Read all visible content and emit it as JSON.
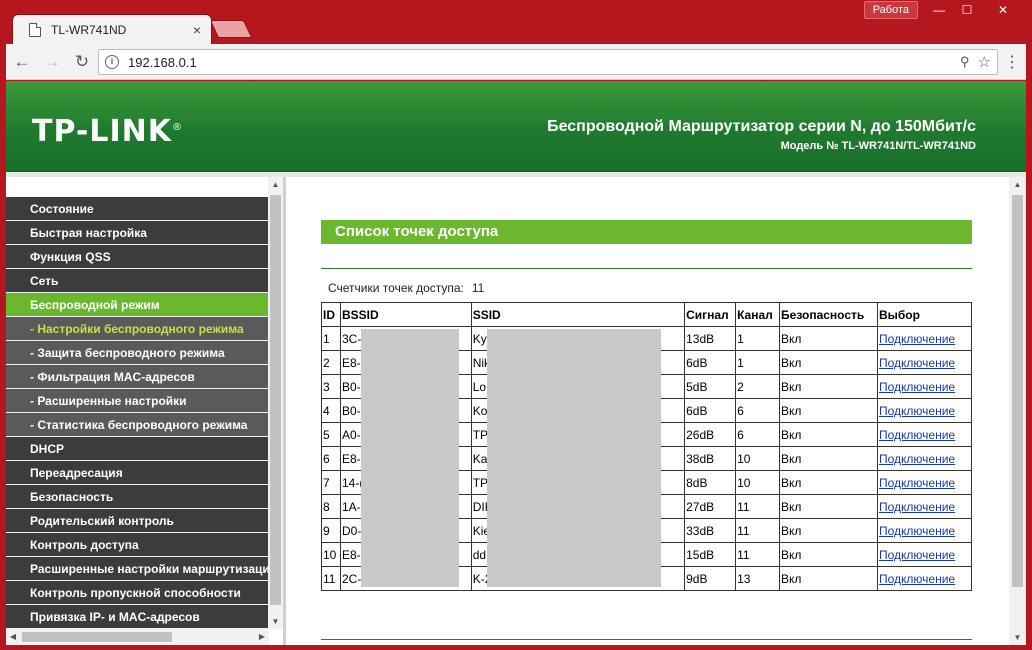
{
  "browser": {
    "tab_title": "TL-WR741ND",
    "tab_close": "×",
    "profile_label": "Работа",
    "win_minimize": "—",
    "win_maximize": "☐",
    "win_close": "✕",
    "back": "←",
    "forward": "→",
    "reload": "↻",
    "info": "i",
    "url": "192.168.0.1",
    "key": "⚲",
    "star": "☆",
    "menu": "⋮"
  },
  "banner": {
    "logo": "TP-LINK",
    "logo_mark": "®",
    "title": "Беспроводной Маршрутизатор серии N, до 150Мбит/с",
    "model": "Модель № TL-WR741N/TL-WR741ND"
  },
  "menu": [
    {
      "label": "Состояние",
      "type": "main"
    },
    {
      "label": "Быстрая настройка",
      "type": "main"
    },
    {
      "label": "Функция QSS",
      "type": "main"
    },
    {
      "label": "Сеть",
      "type": "main"
    },
    {
      "label": "Беспроводной режим",
      "type": "active"
    },
    {
      "label": "- Настройки беспроводного режима",
      "type": "sub-active"
    },
    {
      "label": "- Защита беспроводного режима",
      "type": "sub"
    },
    {
      "label": "- Фильтрация MAC-адресов",
      "type": "sub"
    },
    {
      "label": "- Расширенные настройки",
      "type": "sub"
    },
    {
      "label": "- Статистика беспроводного режима",
      "type": "sub"
    },
    {
      "label": "DHCP",
      "type": "main"
    },
    {
      "label": "Переадресация",
      "type": "main"
    },
    {
      "label": "Безопасность",
      "type": "main"
    },
    {
      "label": "Родительский контроль",
      "type": "main"
    },
    {
      "label": "Контроль доступа",
      "type": "main"
    },
    {
      "label": "Расширенные настройки маршрутизации",
      "type": "main"
    },
    {
      "label": "Контроль пропускной способности",
      "type": "main"
    },
    {
      "label": "Привязка IP- и MAC-адресов",
      "type": "main"
    }
  ],
  "main": {
    "section_title": "Список точек доступа",
    "count_label": "Счетчики точек доступа:",
    "count_value": "11",
    "columns": [
      "ID",
      "BSSID",
      "SSID",
      "Сигнал",
      "Канал",
      "Безопасность",
      "Выбор"
    ],
    "rows": [
      [
        "1",
        "3C-",
        "Ky",
        "13dB",
        "1",
        "Вкл",
        "Подключение"
      ],
      [
        "2",
        "E8-",
        "Nik",
        "6dB",
        "1",
        "Вкл",
        "Подключение"
      ],
      [
        "3",
        "B0-",
        "Lo",
        "5dB",
        "2",
        "Вкл",
        "Подключение"
      ],
      [
        "4",
        "B0-",
        "Ko",
        "6dB",
        "6",
        "Вкл",
        "Подключение"
      ],
      [
        "5",
        "A0-",
        "TP",
        "26dB",
        "6",
        "Вкл",
        "Подключение"
      ],
      [
        "6",
        "E8-",
        "Ka",
        "38dB",
        "10",
        "Вкл",
        "Подключение"
      ],
      [
        "7",
        "14-(",
        "TP",
        "8dB",
        "10",
        "Вкл",
        "Подключение"
      ],
      [
        "8",
        "1A-",
        "DIF",
        "27dB",
        "11",
        "Вкл",
        "Подключение"
      ],
      [
        "9",
        "D0-",
        "Kie",
        "33dB",
        "11",
        "Вкл",
        "Подключение"
      ],
      [
        "10",
        "E8-",
        "dd",
        "15dB",
        "11",
        "Вкл",
        "Подключение"
      ],
      [
        "11",
        "2C-",
        "K-2",
        "9dB",
        "13",
        "Вкл",
        "Подключение"
      ]
    ]
  }
}
